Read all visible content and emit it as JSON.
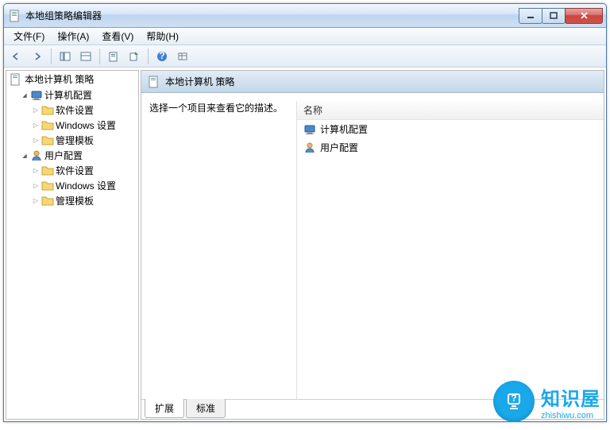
{
  "window": {
    "title": "本地组策略编辑器"
  },
  "menu": {
    "file": "文件(F)",
    "action": "操作(A)",
    "view": "查看(V)",
    "help": "帮助(H)"
  },
  "tree": {
    "root": "本地计算机 策略",
    "computer": {
      "label": "计算机配置",
      "software": "软件设置",
      "windows": "Windows 设置",
      "templates": "管理模板"
    },
    "user": {
      "label": "用户配置",
      "software": "软件设置",
      "windows": "Windows 设置",
      "templates": "管理模板"
    }
  },
  "detail": {
    "title": "本地计算机 策略",
    "description": "选择一个项目来查看它的描述。",
    "columns": {
      "name": "名称"
    },
    "items": {
      "computer": "计算机配置",
      "user": "用户配置"
    }
  },
  "tabs": {
    "extended": "扩展",
    "standard": "标准"
  },
  "watermark": {
    "cn": "知识屋",
    "en": "zhishiwu.com"
  }
}
